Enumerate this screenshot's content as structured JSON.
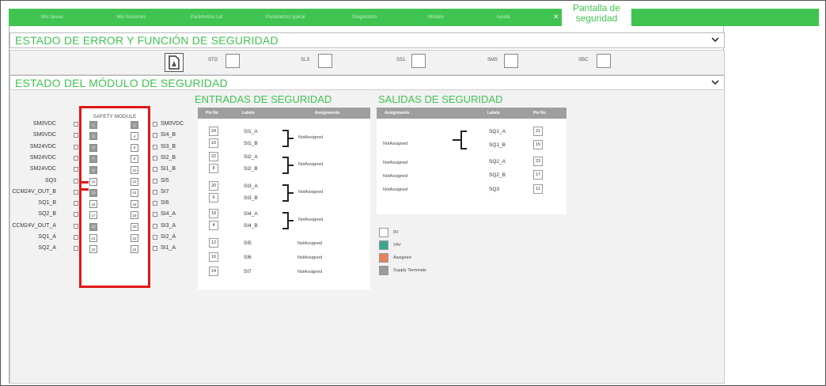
{
  "colors": {
    "brand_green": "#3fc451",
    "red_outline": "#e01818",
    "supply_gray": "#9b9b9b",
    "v24_teal": "#3aa88c",
    "assigned_orange": "#e9815e"
  },
  "tabs": {
    "items": [
      "Mis tareas",
      "Mis funciones",
      "Parámetros Lid",
      "Parámetros typical",
      "Diagnóstico",
      "Módulo",
      "Ayuda"
    ],
    "active_label": "Pantalla de seguridad"
  },
  "error_section": {
    "title": "ESTADO DE ERROR Y FUNCIÓN DE SEGURIDAD",
    "functions": [
      "STO",
      "SLS",
      "SS1",
      "SMS",
      "SBC"
    ]
  },
  "module_section": {
    "title": "ESTADO DEL MÓDULO DE SEGURIDAD",
    "module_title": "SAFETY MODULE",
    "left_labels": [
      "SM0VDC",
      "SM0VDC",
      "SM24VDC",
      "SM24VDC",
      "SM24VDC",
      "SQ3",
      "CCM24V_OUT_B",
      "SQ1_B",
      "SQ2_B",
      "CCM24V_OUT_A",
      "SQ1_A",
      "SQ2_A"
    ],
    "left_pins": [
      "1",
      "3",
      "5",
      "7",
      "9",
      "11",
      "13",
      "15",
      "17",
      "19",
      "21",
      "23"
    ],
    "right_pins": [
      "2",
      "4",
      "6",
      "8",
      "10",
      "12",
      "14",
      "16",
      "18",
      "20",
      "22",
      "24"
    ],
    "right_labels": [
      "SM0VDC",
      "SI4_B",
      "SI3_B",
      "SI2_B",
      "SI1_B",
      "SI5",
      "SI7",
      "SI6",
      "SI4_A",
      "SI3_A",
      "SI2_A",
      "SI1_A"
    ]
  },
  "inputs": {
    "title": "ENTRADAS DE SEGURIDAD",
    "headers": [
      "Pin No",
      "Labels",
      "Assignments"
    ],
    "pins": [
      "24",
      "10",
      "22",
      "8",
      "20",
      "6",
      "18",
      "4",
      "12",
      "16",
      "14"
    ],
    "labels": [
      "SI1_A",
      "SI1_B",
      "SI2_A",
      "SI2_B",
      "SI3_A",
      "SI3_B",
      "SI4_A",
      "SI4_B",
      "SI5",
      "SI6",
      "SI7"
    ],
    "group_assignments": [
      "NotAssigned",
      "NotAssigned",
      "NotAssigned",
      "NotAssigned"
    ],
    "single_assignments": [
      "NotAssigned",
      "NotAssigned",
      "NotAssigned"
    ]
  },
  "outputs": {
    "title": "SALIDAS DE SEGURIDAD",
    "headers": [
      "Assignments",
      "Labels",
      "Pin No"
    ],
    "assignments": [
      "NotAssigned",
      "NotAssigned",
      "NotAssigned",
      "NotAssigned"
    ],
    "labels": [
      "SQ1_A",
      "SQ1_B",
      "SQ2_A",
      "SQ2_B",
      "SQ3"
    ],
    "pins": [
      "21",
      "15",
      "23",
      "17",
      "11"
    ]
  },
  "legend": [
    "0V",
    "24V",
    "Assigned",
    "Supply Terminals"
  ]
}
